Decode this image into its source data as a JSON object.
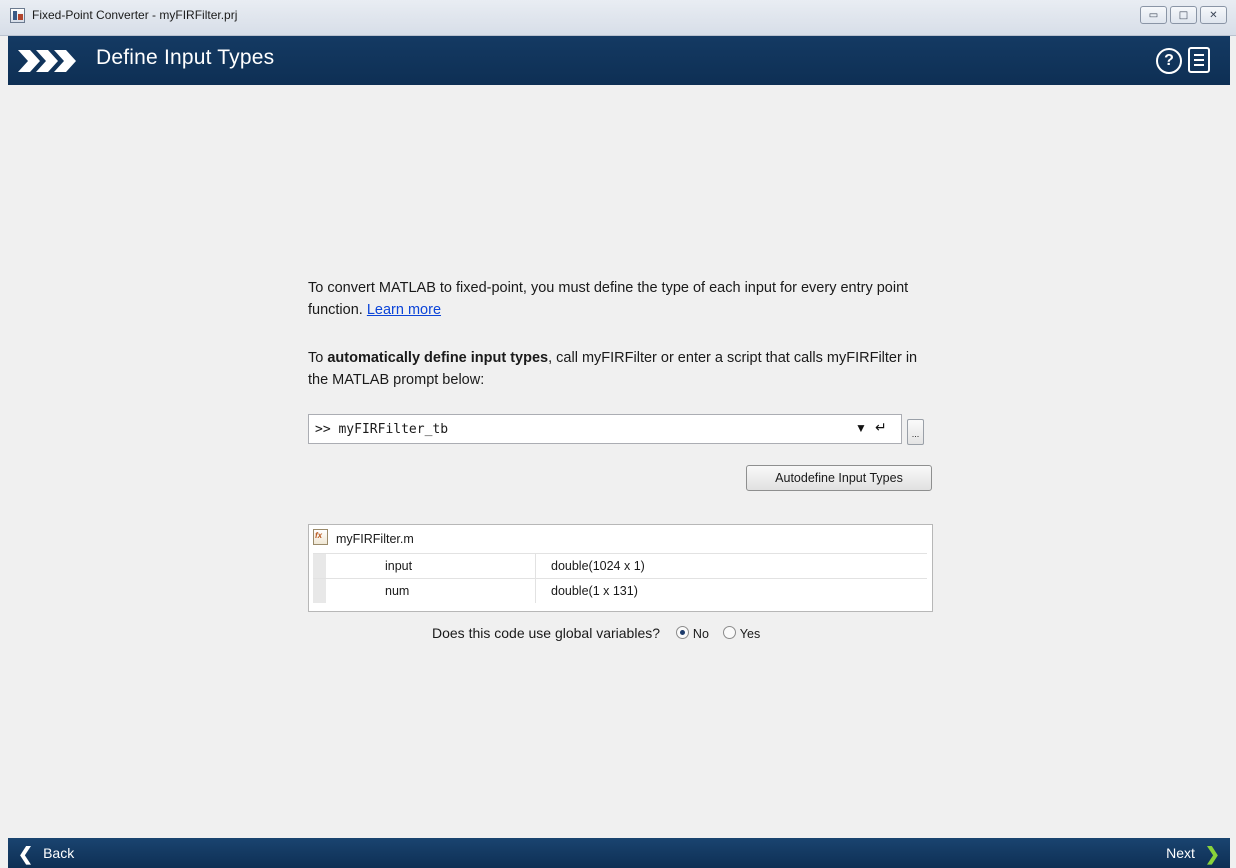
{
  "window": {
    "title": "Fixed-Point Converter - myFIRFilter.prj",
    "minimize_label": "▭",
    "maximize_label": "□",
    "close_label": "✕"
  },
  "header": {
    "title": "Define Input Types",
    "help_label": "?",
    "background": "#143a63"
  },
  "main": {
    "intro_text": "To convert MATLAB to fixed-point, you must define the type of each input for every entry point function.",
    "learn_more_label": "Learn more",
    "auto_prefix": "To ",
    "auto_bold": "automatically define input types",
    "auto_suffix": ", call myFIRFilter or enter a script that calls myFIRFilter in the MATLAB prompt below:",
    "command_prompt": ">> myFIRFilter_tb",
    "command_dropdown_icon": "▼",
    "command_enter_icon": "↵",
    "browse_label": "...",
    "autodefine_label": "Autodefine Input Types",
    "function_file": "myFIRFilter.m",
    "function_icon_label": "fx",
    "inputs": [
      {
        "name": "input",
        "type": "double(1024 x 1)"
      },
      {
        "name": "num",
        "type": "double(1 x 131)"
      }
    ],
    "globals_question": "Does this code use global variables?",
    "globals_options": [
      {
        "label": "No",
        "selected": true
      },
      {
        "label": "Yes",
        "selected": false
      }
    ]
  },
  "footer": {
    "back_label": "Back",
    "next_label": "Next",
    "next_accent": "#8ad33a"
  }
}
